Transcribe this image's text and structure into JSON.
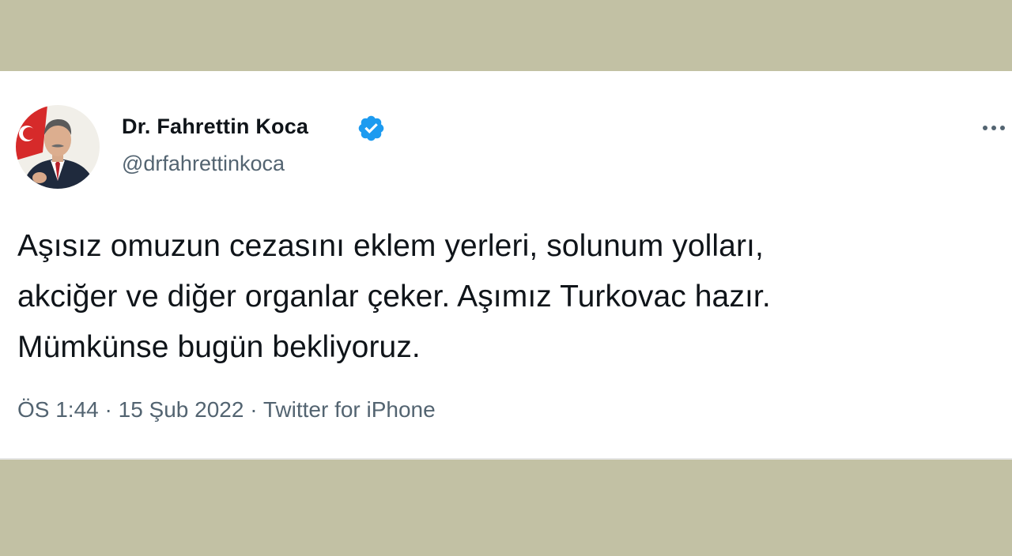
{
  "tweet": {
    "author_name": "Dr. Fahrettin Koca",
    "author_handle": "@drfahrettinkoca",
    "verified": true,
    "text_lines": [
      "Aşısız omuzun cezasını eklem yerleri, solunum yolları,",
      "akciğer ve diğer organlar çeker. Aşımız Turkovac hazır.",
      "Mümkünse bugün bekliyoruz."
    ],
    "time": "ÖS 1:44",
    "separator": "·",
    "date": "15 Şub 2022",
    "source": "Twitter for iPhone"
  },
  "icons": {
    "verified": "verified-badge-icon",
    "more": "more-options-icon"
  },
  "colors": {
    "background_band": "#c2c1a4",
    "card": "#ffffff",
    "verified_blue": "#1d9bf0",
    "text_primary": "#0f1419",
    "text_secondary": "#536471"
  }
}
